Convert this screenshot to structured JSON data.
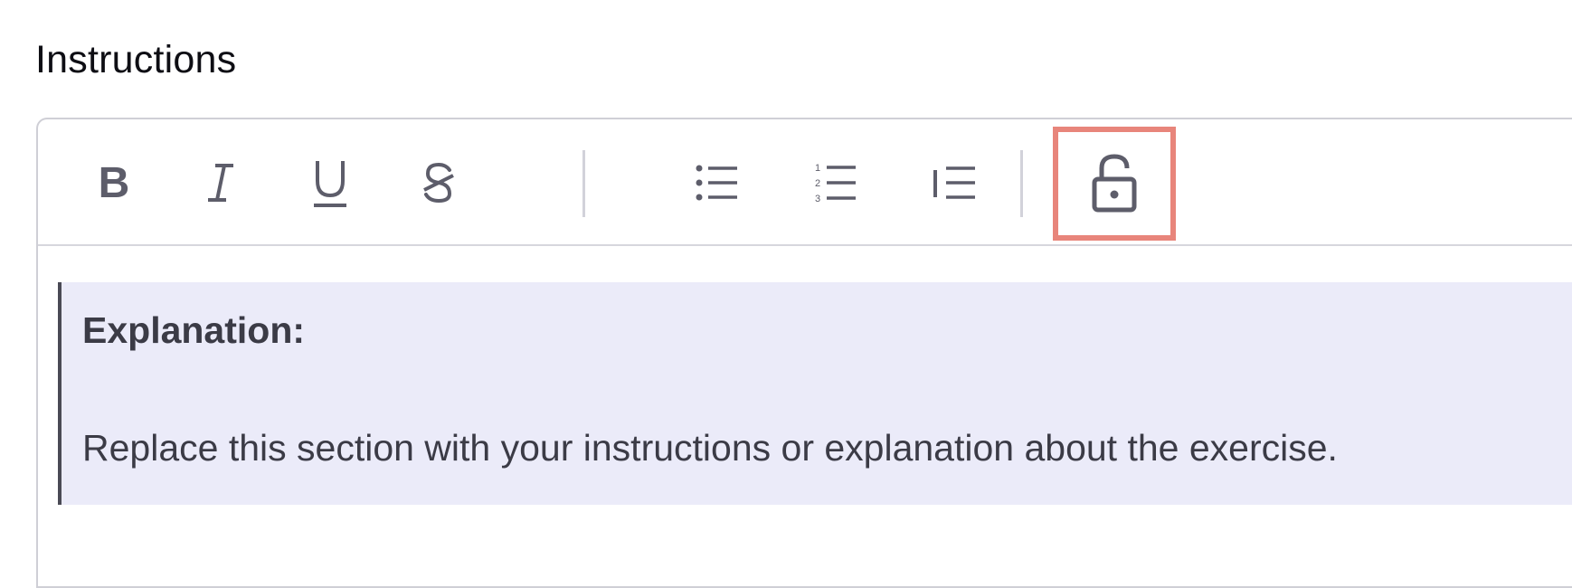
{
  "section": {
    "label": "Instructions"
  },
  "toolbar": {
    "buttons": [
      {
        "name": "bold-button",
        "icon": "bold-icon"
      },
      {
        "name": "italic-button",
        "icon": "italic-icon"
      },
      {
        "name": "underline-button",
        "icon": "underline-icon"
      },
      {
        "name": "strikethrough-button",
        "icon": "strikethrough-icon"
      },
      {
        "name": "bullet-list-button",
        "icon": "bullet-list-icon"
      },
      {
        "name": "numbered-list-button",
        "icon": "numbered-list-icon"
      },
      {
        "name": "blockquote-button",
        "icon": "blockquote-icon"
      },
      {
        "name": "lock-button",
        "icon": "unlock-icon",
        "highlighted": true
      }
    ],
    "glyphs": {
      "bold": "B",
      "italic": "I",
      "underline": "U",
      "strike": "S"
    }
  },
  "content": {
    "blockquote_title": "Explanation:",
    "blockquote_body": "Replace this section with your instructions or explanation about the exercise."
  },
  "colors": {
    "icon": "#5d5d6a",
    "highlight": "#e8857b",
    "blockquote_bg": "#ebebf9"
  }
}
